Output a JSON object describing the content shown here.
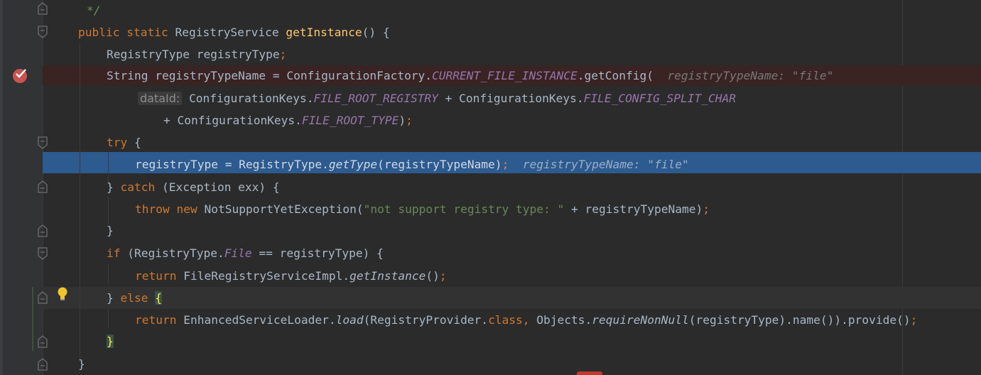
{
  "editor": {
    "colors": {
      "background": "#2b2b2b",
      "keyword": "#cc7832",
      "method": "#ffc66d",
      "static_field": "#9876aa",
      "string": "#6a8759",
      "execution_line": "#2d5a8f",
      "breakpoint_line": "#3a2323"
    },
    "icons": [
      "breakpoint-check-icon",
      "intention-bulb-icon",
      "fold-icon"
    ],
    "lines": {
      "l0": {
        "comment": "*/"
      },
      "l1": {
        "k1": "public",
        "k2": "static",
        "type": "RegistryService",
        "fn": "getInstance",
        "rest": "() {"
      },
      "l2": {
        "text": "RegistryType registryType",
        "semi": ";"
      },
      "l3": {
        "a": "String registryTypeName = ConfigurationFactory.",
        "field": "CURRENT_FILE_INSTANCE",
        "b": ".getConfig(",
        "hint": "registryTypeName: \"file\""
      },
      "l4": {
        "label": "dataId:",
        "a": "ConfigurationKeys.",
        "f1": "FILE_ROOT_REGISTRY",
        "b": " + ConfigurationKeys.",
        "f2": "FILE_CONFIG_SPLIT_CHAR"
      },
      "l5": {
        "a": "+ ConfigurationKeys.",
        "f": "FILE_ROOT_TYPE",
        "b": ")",
        "semi": ";"
      },
      "l6": {
        "kw": "try",
        "rest": " {"
      },
      "l7": {
        "a": "registryType = RegistryType.",
        "m": "getType",
        "b": "(registryTypeName)",
        "semi": ";",
        "hint": "registryTypeName: \"file\""
      },
      "l8": {
        "a": "} ",
        "kw": "catch",
        "b": " (Exception exx) {"
      },
      "l9": {
        "k1": "throw",
        "k2": "new",
        "a": " NotSupportYetException(",
        "str": "\"not support registry type: \"",
        "b": " + registryTypeName)",
        "semi": ";"
      },
      "l10": {
        "text": "}"
      },
      "l11": {
        "kw": "if",
        "a": " (RegistryType.",
        "f": "File",
        "b": " == registryType) {"
      },
      "l12": {
        "kw": "return",
        "a": " FileRegistryServiceImpl.",
        "m": "getInstance",
        "b": "()",
        "semi": ";"
      },
      "l13": {
        "a": "} ",
        "kw": "else",
        "sp": " ",
        "brace": "{"
      },
      "l14": {
        "kw": "return",
        "a": " EnhancedServiceLoader.",
        "m": "load",
        "b": "(RegistryProvider.",
        "cls": "class,",
        "c": " Objects.",
        "m2": "requireNonNull",
        "d": "(registryType).name()).provide()",
        "semi": ";"
      },
      "l15": {
        "brace": "}"
      },
      "l16": {
        "text": "}"
      }
    }
  }
}
